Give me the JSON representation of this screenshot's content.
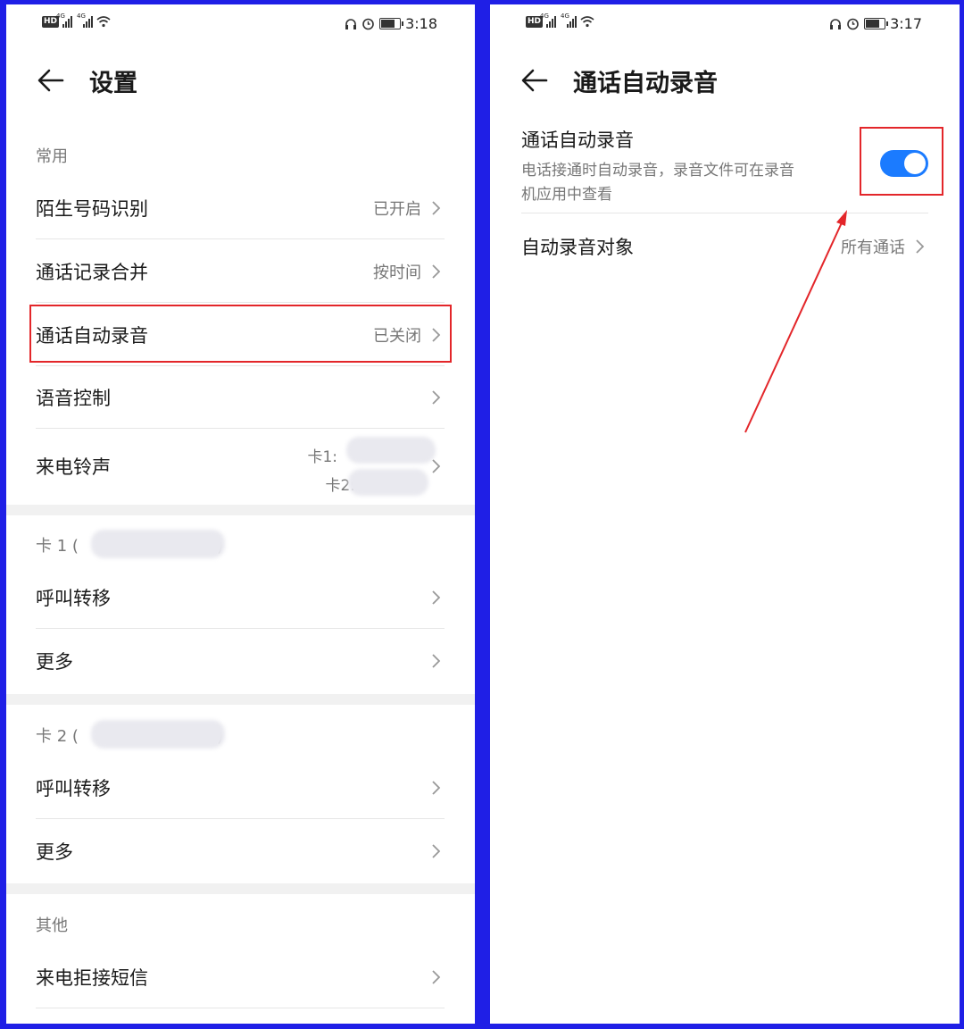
{
  "left": {
    "status": {
      "time": "3:18",
      "hd": "HD",
      "net1": "4G",
      "net2": "4G"
    },
    "title": "设置",
    "section_common": "常用",
    "rows_common": [
      {
        "label": "陌生号码识别",
        "value": "已开启"
      },
      {
        "label": "通话记录合并",
        "value": "按时间"
      },
      {
        "label": "通话自动录音",
        "value": "已关闭"
      },
      {
        "label": "语音控制",
        "value": ""
      },
      {
        "label": "来电铃声",
        "value1": "卡1: ",
        "value2": "卡2: "
      }
    ],
    "section_card1": {
      "prefix": "卡 1 (",
      "suffix": ")"
    },
    "rows_card1": [
      {
        "label": "呼叫转移"
      },
      {
        "label": "更多"
      }
    ],
    "section_card2": {
      "prefix": "卡 2 (",
      "suffix": ")"
    },
    "rows_card2": [
      {
        "label": "呼叫转移"
      },
      {
        "label": "更多"
      }
    ],
    "section_other": "其他",
    "rows_other": [
      {
        "label": "来电拒接短信"
      }
    ]
  },
  "right": {
    "status": {
      "time": "3:17",
      "hd": "HD",
      "net1": "4G",
      "net2": "4G"
    },
    "title": "通话自动录音",
    "toggle_row": {
      "label": "通话自动录音",
      "desc1": "电话接通时自动录音，录音文件可在录音",
      "desc2": "机应用中查看",
      "on": true
    },
    "target_row": {
      "label": "自动录音对象",
      "value": "所有通话"
    }
  },
  "colors": {
    "frame": "#1f1fe6",
    "accent": "#1b7bff",
    "highlight": "#e3262a"
  }
}
